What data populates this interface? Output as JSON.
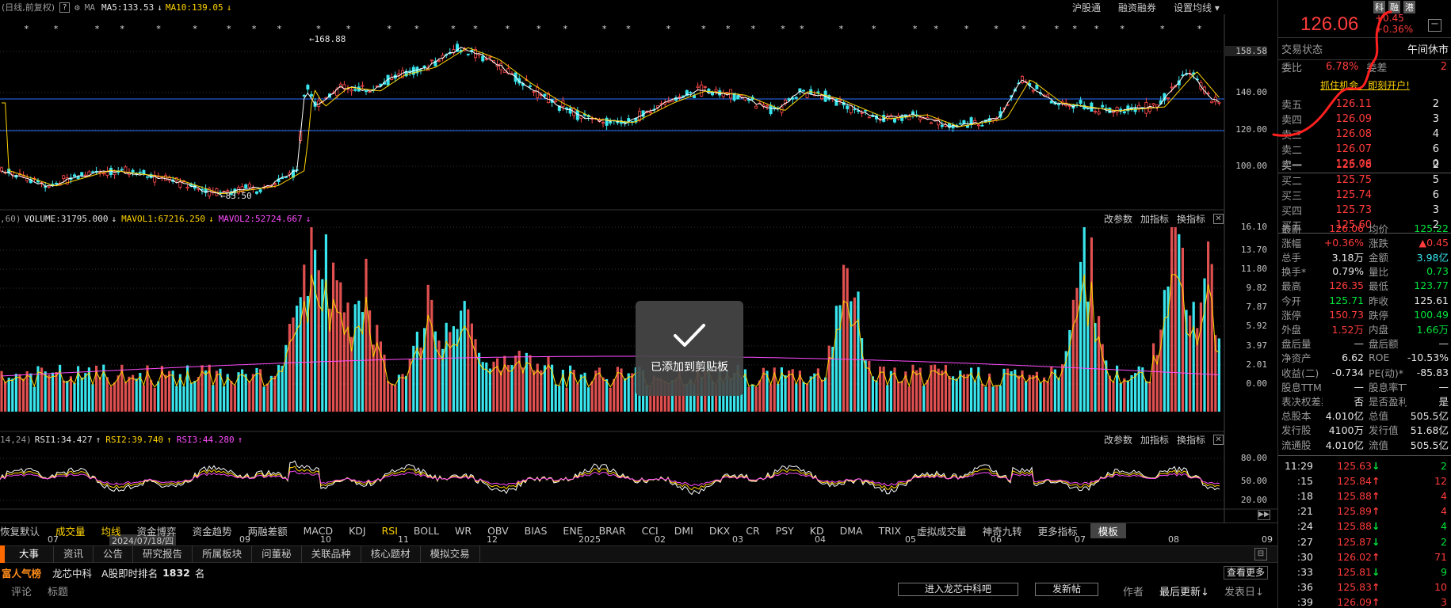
{
  "chart_header": {
    "period": "(日线,前复权)",
    "ma_label": "MA",
    "ma5": "MA5:133.53",
    "ma10": "MA10:139.05",
    "arrow_down": "↓",
    "links": [
      "沪股通",
      "融资融券",
      "设置均线"
    ]
  },
  "price_panel": {
    "axis_labels": [
      "158.58",
      "140.00",
      "120.00",
      "100.00"
    ],
    "high_marker": "←168.88",
    "low_marker": "←83.50"
  },
  "volume_panel": {
    "prefix": ",60)",
    "volume": "VOLUME:31795.000",
    "mavol1": "MAVOL1:67216.250",
    "mavol2": "MAVOL2:52724.667",
    "buttons": [
      "改参数",
      "加指标",
      "换指标"
    ],
    "close": "✕",
    "axis_labels": [
      "16.10",
      "13.70",
      "11.80",
      "9.82",
      "7.87",
      "5.92",
      "3.97",
      "2.01",
      "0.00"
    ]
  },
  "rsi_panel": {
    "prefix": "14,24)",
    "rsi1": "RSI1:34.427",
    "rsi2": "RSI2:39.740",
    "rsi3": "RSI3:44.280",
    "buttons": [
      "改参数",
      "加指标",
      "换指标"
    ],
    "close": "✕",
    "axis_labels": [
      "80.00",
      "50.00",
      "20.00"
    ]
  },
  "x_axis": {
    "labels": [
      "07",
      "2024/07/18/四",
      "09",
      "10",
      "11",
      "12",
      "2025",
      "02",
      "03",
      "04",
      "05",
      "06",
      "07",
      "08",
      "09"
    ]
  },
  "indicator_tabs": [
    "恢复默认",
    "成交量",
    "均线",
    "资金博弈",
    "资金趋势",
    "两融差额",
    "MACD",
    "KDJ",
    "RSI",
    "BOLL",
    "WR",
    "OBV",
    "BIAS",
    "ENE",
    "BRAR",
    "CCI",
    "DMI",
    "DKX",
    "CR",
    "PSY",
    "KD",
    "DMA",
    "TRIX",
    "虚拟成交量",
    "神奇九转",
    "更多指标",
    "模板"
  ],
  "info_tabs": [
    "大事",
    "资讯",
    "公告",
    "研究报告",
    "所属板块",
    "问董秘",
    "关联品种",
    "核心题材",
    "模拟交易"
  ],
  "popularity": {
    "title": "富人气榜",
    "stock": "龙芯中科",
    "rank_text": "A股即时排名",
    "rank": "1832",
    "unit": "名",
    "more": "查看更多"
  },
  "forum": {
    "col_comment": "评论",
    "col_title": "标题",
    "enter_button": "进入龙芯中科吧",
    "post_button": "发新帖",
    "col_author": "作者",
    "col_latest": "最后更新↓",
    "col_post_time": "发表日↓"
  },
  "toast": {
    "text": "已添加到剪贴板"
  },
  "right_panel": {
    "tags": [
      "科",
      "融",
      "港"
    ],
    "price": "126.06",
    "change": "+0.45",
    "change_pct": "+0.36%",
    "status_label": "交易状态",
    "status_value": "午间休市",
    "weibi_label": "委比",
    "weibi_value": "6.78%",
    "weicha_label": "委差",
    "weicha_value": "2",
    "promo": "抓住机会，即刻开户!",
    "sells": [
      {
        "label": "卖五",
        "price": "126.11",
        "vol": "2"
      },
      {
        "label": "卖四",
        "price": "126.09",
        "vol": "3"
      },
      {
        "label": "卖三",
        "price": "126.08",
        "vol": "4"
      },
      {
        "label": "卖二",
        "price": "126.07",
        "vol": "6"
      },
      {
        "label": "卖一",
        "price": "126.06",
        "vol": "0"
      }
    ],
    "buys": [
      {
        "label": "买一",
        "price": "125.78",
        "vol": "2"
      },
      {
        "label": "买二",
        "price": "125.75",
        "vol": "5"
      },
      {
        "label": "买三",
        "price": "125.74",
        "vol": "6"
      },
      {
        "label": "买四",
        "price": "125.73",
        "vol": "3"
      },
      {
        "label": "买五",
        "price": "125.60",
        "vol": "2"
      }
    ],
    "stats": [
      {
        "l1": "最新",
        "v1": "126.06",
        "c1": "red",
        "l2": "均价",
        "v2": "125.22",
        "c2": "green"
      },
      {
        "l1": "涨幅",
        "v1": "+0.36%",
        "c1": "red",
        "l2": "涨跌",
        "v2": "▲0.45",
        "c2": "red"
      },
      {
        "l1": "总手",
        "v1": "3.18万",
        "c1": "white",
        "l2": "金额",
        "v2": "3.98亿",
        "c2": "cyan"
      },
      {
        "l1": "换手*",
        "v1": "0.79%",
        "c1": "white",
        "l2": "量比",
        "v2": "0.73",
        "c2": "green"
      },
      {
        "l1": "最高",
        "v1": "126.35",
        "c1": "red",
        "l2": "最低",
        "v2": "123.77",
        "c2": "green"
      },
      {
        "l1": "今开",
        "v1": "125.71",
        "c1": "green",
        "l2": "昨收",
        "v2": "125.61",
        "c2": "white"
      },
      {
        "l1": "涨停",
        "v1": "150.73",
        "c1": "red",
        "l2": "跌停",
        "v2": "100.49",
        "c2": "green"
      },
      {
        "l1": "外盘",
        "v1": "1.52万",
        "c1": "red",
        "l2": "内盘",
        "v2": "1.66万",
        "c2": "green"
      },
      {
        "l1": "盘后量",
        "v1": "—",
        "c1": "white",
        "l2": "盘后额",
        "v2": "—",
        "c2": "white"
      },
      {
        "l1": "净资产",
        "v1": "6.62",
        "c1": "white",
        "l2": "ROE",
        "v2": "-10.53%",
        "c2": "white"
      },
      {
        "l1": "收益(二)",
        "v1": "-0.734",
        "c1": "white",
        "l2": "PE(动)*",
        "v2": "-85.83",
        "c2": "white"
      },
      {
        "l1": "股息TTM",
        "v1": "—",
        "c1": "white",
        "l2": "股息率TTM",
        "v2": "—",
        "c2": "white"
      },
      {
        "l1": "表决权差异",
        "v1": "否",
        "c1": "white",
        "l2": "是否盈利",
        "v2": "是",
        "c2": "white"
      },
      {
        "l1": "总股本",
        "v1": "4.010亿",
        "c1": "white",
        "l2": "总值",
        "v2": "505.5亿",
        "c2": "white"
      },
      {
        "l1": "发行股",
        "v1": "4100万",
        "c1": "white",
        "l2": "发行值",
        "v2": "51.68亿",
        "c2": "white"
      },
      {
        "l1": "流通股",
        "v1": "4.010亿",
        "c1": "white",
        "l2": "流值",
        "v2": "505.5亿",
        "c2": "white"
      }
    ],
    "ticks": [
      {
        "time": "11:29",
        "price": "125.63",
        "dir": "↓",
        "dc": "green",
        "vol": "2",
        "vc": "green"
      },
      {
        "time": ":15",
        "price": "125.84",
        "dir": "↑",
        "dc": "red",
        "vol": "12",
        "vc": "red"
      },
      {
        "time": ":18",
        "price": "125.88",
        "dir": "↑",
        "dc": "red",
        "vol": "4",
        "vc": "red"
      },
      {
        "time": ":21",
        "price": "125.89",
        "dir": "↑",
        "dc": "red",
        "vol": "4",
        "vc": "red"
      },
      {
        "time": ":24",
        "price": "125.88",
        "dir": "↓",
        "dc": "green",
        "vol": "4",
        "vc": "green"
      },
      {
        "time": ":27",
        "price": "125.87",
        "dir": "↓",
        "dc": "green",
        "vol": "2",
        "vc": "green"
      },
      {
        "time": ":30",
        "price": "126.02",
        "dir": "↑",
        "dc": "red",
        "vol": "71",
        "vc": "red"
      },
      {
        "time": ":33",
        "price": "125.81",
        "dir": "↓",
        "dc": "green",
        "vol": "9",
        "vc": "green"
      },
      {
        "time": ":36",
        "price": "125.83",
        "dir": "↑",
        "dc": "red",
        "vol": "10",
        "vc": "red"
      },
      {
        "time": ":39",
        "price": "126.09",
        "dir": "↑",
        "dc": "red",
        "vol": "3",
        "vc": "red"
      }
    ]
  }
}
